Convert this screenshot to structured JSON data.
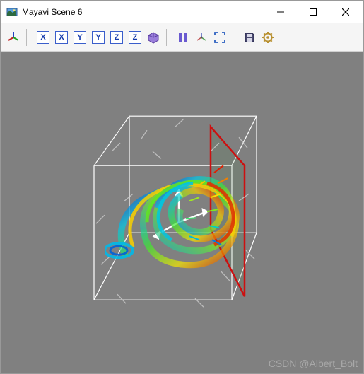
{
  "window": {
    "title": "Mayavi Scene 6",
    "icon": "scene-icon"
  },
  "win_controls": {
    "minimize": "—",
    "maximize": "☐",
    "close": "✕"
  },
  "toolbar": {
    "orientation_icon": "orientation-triad-icon",
    "axis_views": [
      "X",
      "X",
      "Y",
      "Y",
      "Z",
      "Z"
    ],
    "iso_icon": "isometric-view-icon",
    "parallel_icon": "parallel-projection-icon",
    "axes_toggle_icon": "toggle-axes-icon",
    "fullscreen_icon": "fullscreen-icon",
    "save_icon": "save-scene-icon",
    "settings_icon": "configure-scene-icon"
  },
  "viewport": {
    "background": "#808080",
    "bounding_box_color": "#ffffff",
    "slice_plane_color": "#cc1010",
    "colormap_hint": "jet",
    "content_description": "3D vector-field tornado with streamlines and arrows inside white wireframe cube, red slice plane"
  },
  "watermark": "CSDN @Albert_Bolt",
  "overlay_tag": ""
}
